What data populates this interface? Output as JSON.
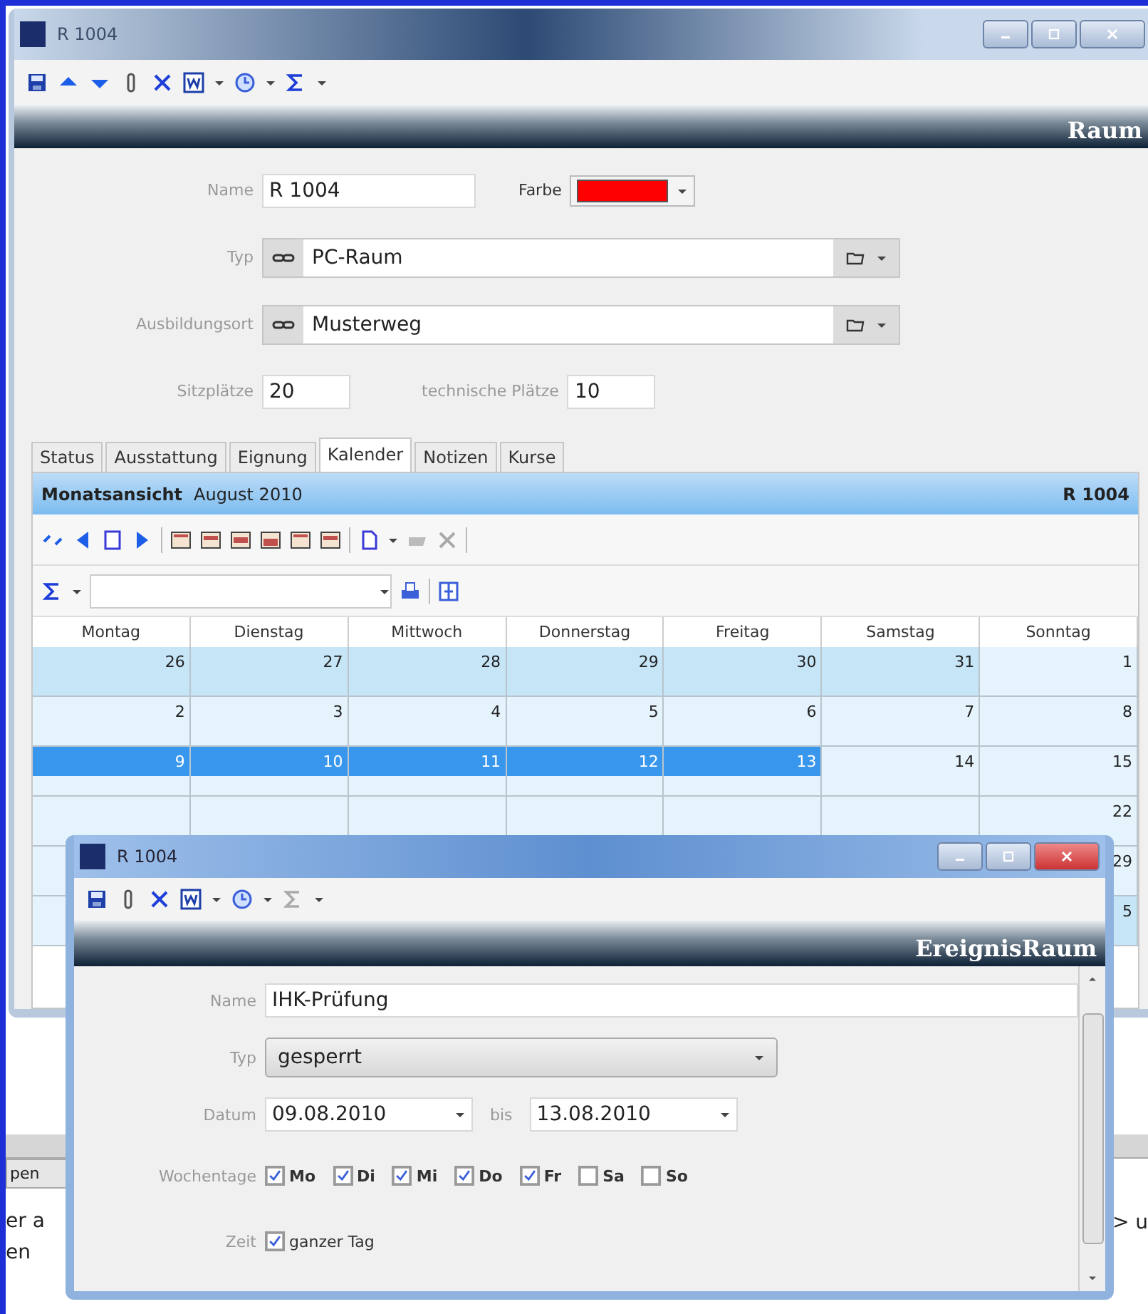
{
  "window": {
    "title": "R 1004",
    "header": "Raum"
  },
  "form": {
    "name_label": "Name",
    "name": "R 1004",
    "color_label": "Farbe",
    "color": "#ff0000",
    "type_label": "Typ",
    "type": "PC-Raum",
    "location_label": "Ausbildungsort",
    "location": "Musterweg",
    "seats_label": "Sitzplätze",
    "seats": "20",
    "tech_label": "technische Plätze",
    "tech_seats": "10"
  },
  "tabs": [
    {
      "label": "Status",
      "selected": false
    },
    {
      "label": "Ausstattung",
      "selected": false
    },
    {
      "label": "Eignung",
      "selected": false
    },
    {
      "label": "Kalender",
      "selected": true
    },
    {
      "label": "Notizen",
      "selected": false
    },
    {
      "label": "Kurse",
      "selected": false
    }
  ],
  "calendar": {
    "view": "Monatsansicht",
    "month": "August 2010",
    "room": "R 1004",
    "columns": [
      "Montag",
      "Dienstag",
      "Mittwoch",
      "Donnerstag",
      "Freitag",
      "Samstag",
      "Sonntag"
    ],
    "weeks": [
      {
        "days": [
          {
            "text": "26",
            "kind": "outside",
            "selected": false
          },
          {
            "text": "27",
            "kind": "outside",
            "selected": false
          },
          {
            "text": "28",
            "kind": "outside",
            "selected": false
          },
          {
            "text": "29",
            "kind": "outside",
            "selected": false
          },
          {
            "text": "30",
            "kind": "outside",
            "selected": false
          },
          {
            "text": "31",
            "kind": "outside",
            "selected": false
          },
          {
            "text": "1",
            "kind": "inside",
            "selected": false
          }
        ]
      },
      {
        "days": [
          {
            "text": "2",
            "kind": "inside",
            "selected": false
          },
          {
            "text": "3",
            "kind": "inside",
            "selected": false
          },
          {
            "text": "4",
            "kind": "inside",
            "selected": false
          },
          {
            "text": "5",
            "kind": "inside",
            "selected": false
          },
          {
            "text": "6",
            "kind": "inside",
            "selected": false
          },
          {
            "text": "7",
            "kind": "inside",
            "selected": false
          },
          {
            "text": "8",
            "kind": "inside",
            "selected": false
          }
        ]
      },
      {
        "days": [
          {
            "text": "9",
            "kind": "inside",
            "selected": true
          },
          {
            "text": "10",
            "kind": "inside",
            "selected": true
          },
          {
            "text": "11",
            "kind": "inside",
            "selected": true
          },
          {
            "text": "12",
            "kind": "inside",
            "selected": true
          },
          {
            "text": "13",
            "kind": "inside",
            "selected": true
          },
          {
            "text": "14",
            "kind": "inside",
            "selected": false
          },
          {
            "text": "15",
            "kind": "inside",
            "selected": false
          }
        ]
      },
      {
        "days": [
          {
            "text": "22",
            "kind": "inside",
            "selected": false
          }
        ]
      },
      {
        "days": [
          {
            "text": "29",
            "kind": "inside",
            "selected": false
          }
        ]
      },
      {
        "days": [
          {
            "text": "5",
            "kind": "outside",
            "selected": false
          }
        ]
      }
    ]
  },
  "dialog": {
    "title": "R 1004",
    "header": "EreignisRaum",
    "name_label": "Name",
    "name": "IHK-Prüfung",
    "type_label": "Typ",
    "type": "gesperrt",
    "date_label": "Datum",
    "date_from": "09.08.2010",
    "to_label": "bis",
    "date_to": "13.08.2010",
    "weekdays_label": "Wochentage",
    "weekdays": [
      {
        "label": "Mo",
        "checked": true
      },
      {
        "label": "Di",
        "checked": true
      },
      {
        "label": "Mi",
        "checked": true
      },
      {
        "label": "Do",
        "checked": true
      },
      {
        "label": "Fr",
        "checked": true
      },
      {
        "label": "Sa",
        "checked": false
      },
      {
        "label": "So",
        "checked": false
      }
    ],
    "time_label": "Zeit",
    "all_day": {
      "label": "ganzer Tag",
      "checked": true
    }
  },
  "background": {
    "tab": "pen",
    "lines": [
      "er a",
      "en"
    ],
    "right_text": "> u"
  }
}
